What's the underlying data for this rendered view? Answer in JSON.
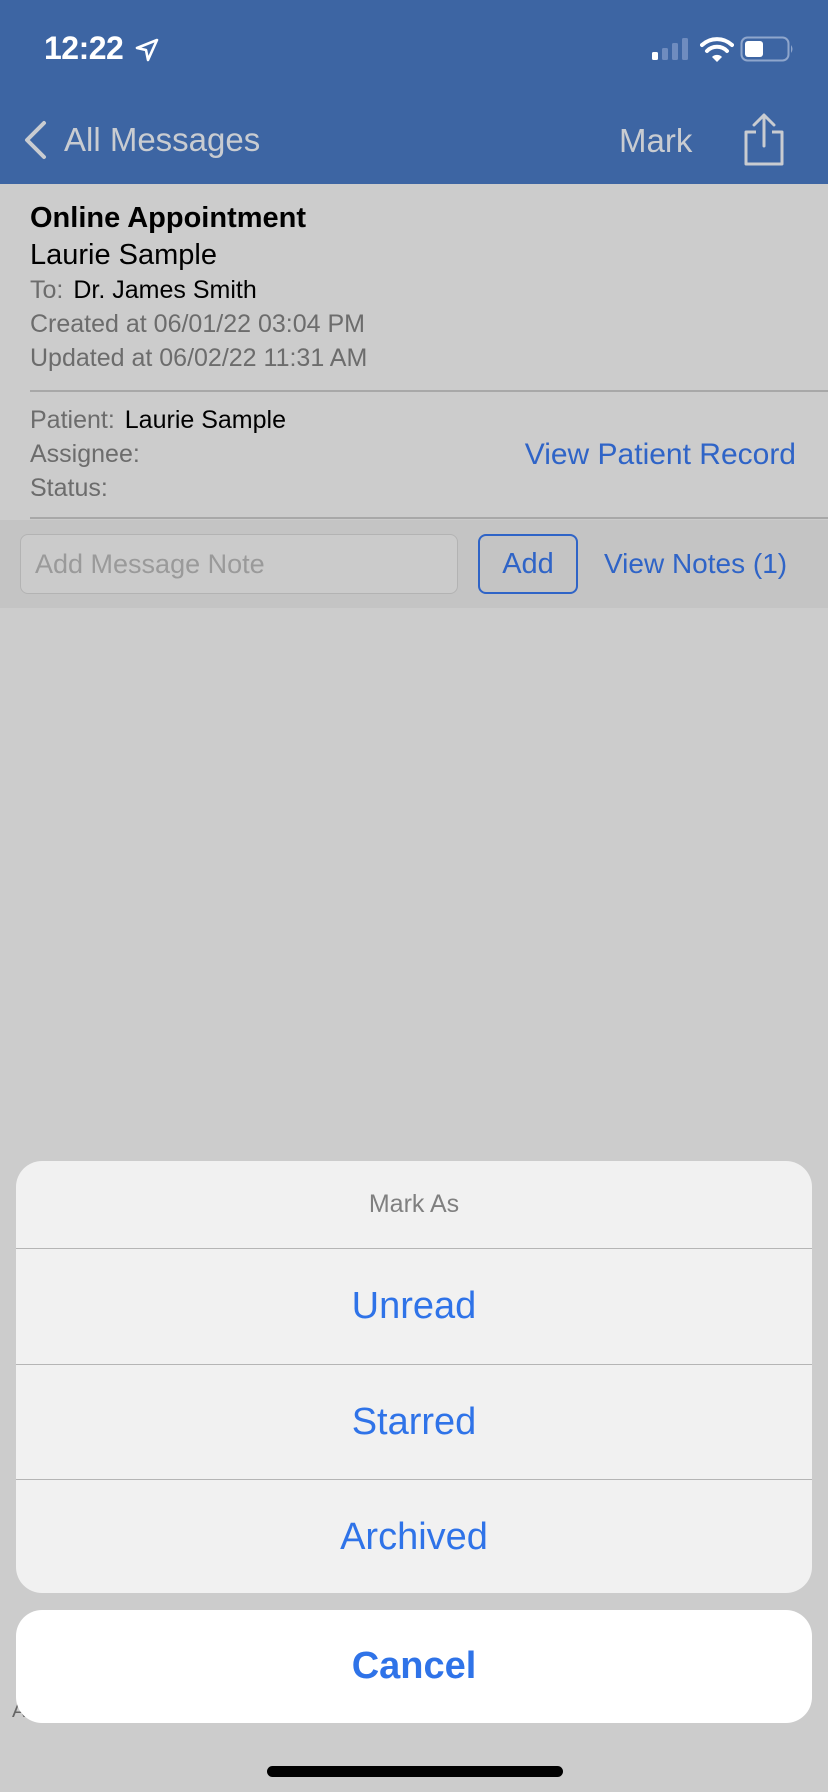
{
  "status_bar": {
    "time": "12:22",
    "icons": [
      "location-arrow-icon",
      "cellular-signal-icon",
      "wifi-icon",
      "battery-icon"
    ]
  },
  "nav": {
    "back_label": "All Messages",
    "mark_label": "Mark",
    "share_icon": "share-icon"
  },
  "message": {
    "subject": "Online Appointment",
    "sender": "Laurie Sample",
    "to_label": "To:",
    "to_value": "Dr. James Smith",
    "created": "Created at 06/01/22 03:04 PM",
    "updated": "Updated at 06/02/22 11:31 AM"
  },
  "patient_info": {
    "patient_label": "Patient:",
    "patient_value": "Laurie Sample",
    "assignee_label": "Assignee:",
    "assignee_value": "",
    "status_label": "Status:",
    "status_value": "",
    "view_record_label": "View Patient Record"
  },
  "notes": {
    "input_placeholder": "Add Message Note",
    "input_value": "",
    "add_label": "Add",
    "view_notes_label": "View Notes (1)"
  },
  "action_sheet": {
    "title": "Mark As",
    "options": [
      {
        "label": "Unread"
      },
      {
        "label": "Starred"
      },
      {
        "label": "Archived"
      }
    ],
    "cancel_label": "Cancel"
  },
  "obscured_text": "A",
  "colors": {
    "header_bg": "#3d65a3",
    "link_blue": "#2f64c7",
    "sheet_blue": "#2f73e8",
    "dim_bg": "#cccccc"
  }
}
